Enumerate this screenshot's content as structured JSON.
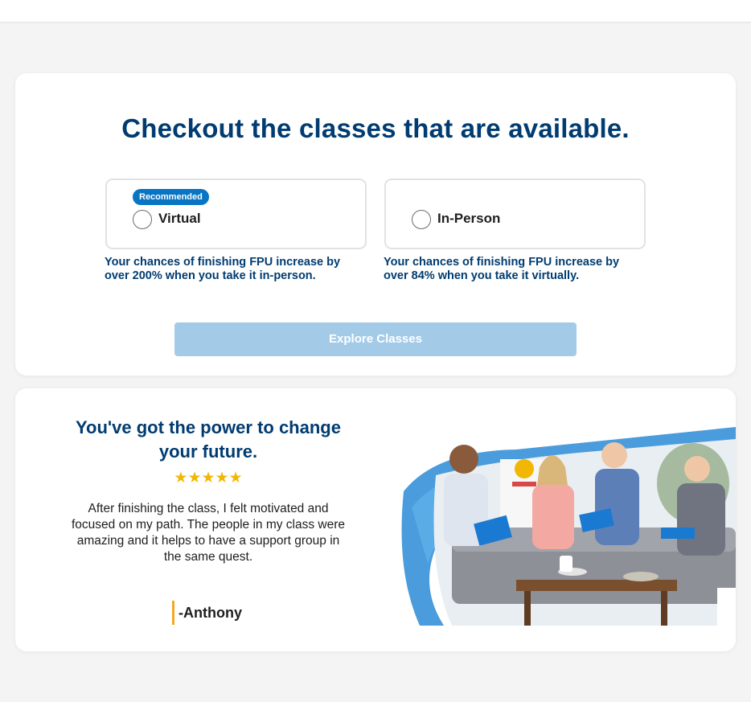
{
  "page": {
    "heading": "Checkout the classes that are available."
  },
  "options": [
    {
      "badge": "Recommended",
      "label": "Virtual",
      "note": "Your chances of finishing FPU increase by over 200% when you take it in-person."
    },
    {
      "badge": "",
      "label": "In-Person",
      "note": "Your chances of finishing FPU increase by over 84% when you take it virtually."
    }
  ],
  "cta": {
    "label": "Explore Classes"
  },
  "testimonial": {
    "title": "You've got the power to change your future.",
    "stars": "★★★★★",
    "rating": 5,
    "quote": "After finishing the class, I felt motivated and focused on my path. The people in my class were amazing and it helps to have a support group in the same quest.",
    "author": "-Anthony"
  },
  "colors": {
    "brand_navy": "#003c71",
    "badge_blue": "#0875c4",
    "button_disabled": "#a3cbe8",
    "star_gold": "#f2b705",
    "accent_orange": "#f5a623"
  }
}
